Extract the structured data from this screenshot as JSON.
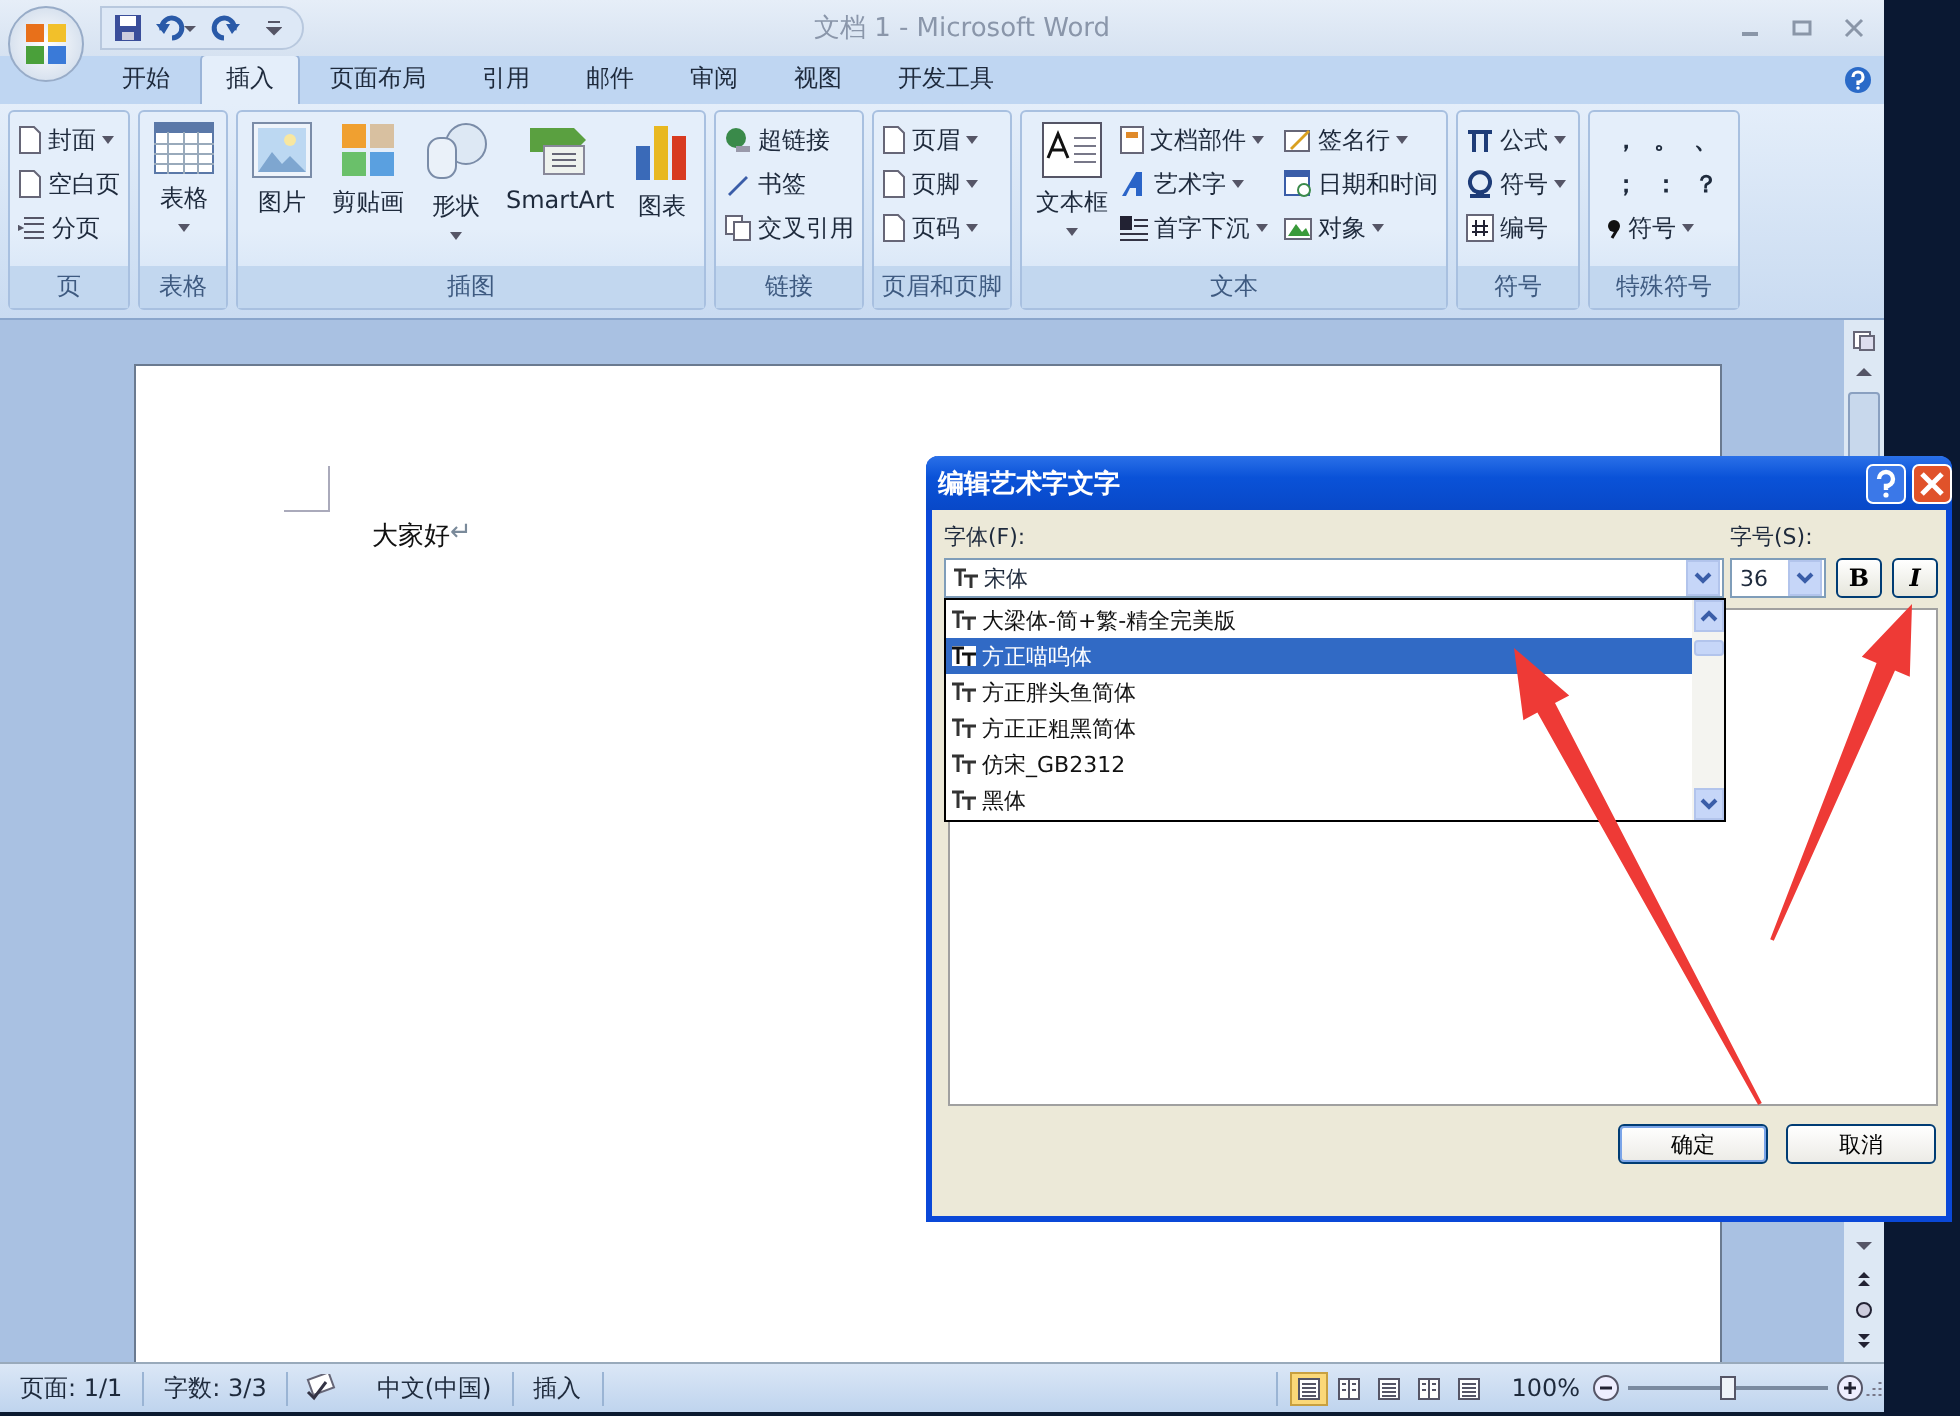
{
  "window": {
    "title": "文档 1 - Microsoft Word"
  },
  "tabs": [
    {
      "label": "开始",
      "selected": false
    },
    {
      "label": "插入",
      "selected": true
    },
    {
      "label": "页面布局",
      "selected": false
    },
    {
      "label": "引用",
      "selected": false
    },
    {
      "label": "邮件",
      "selected": false
    },
    {
      "label": "审阅",
      "selected": false
    },
    {
      "label": "视图",
      "selected": false
    },
    {
      "label": "开发工具",
      "selected": false
    }
  ],
  "ribbon_groups": [
    {
      "label": "页",
      "items": [
        {
          "label": "封面",
          "kind": "small",
          "dropdown": true
        },
        {
          "label": "空白页",
          "kind": "small",
          "dropdown": false
        },
        {
          "label": "分页",
          "kind": "small",
          "dropdown": false
        }
      ]
    },
    {
      "label": "表格",
      "items": [
        {
          "label": "表格",
          "kind": "large",
          "dropdown": true
        }
      ]
    },
    {
      "label": "插图",
      "items": [
        {
          "label": "图片",
          "kind": "large",
          "dropdown": false
        },
        {
          "label": "剪贴画",
          "kind": "large",
          "dropdown": false
        },
        {
          "label": "形状",
          "kind": "large",
          "dropdown": true
        },
        {
          "label": "SmartArt",
          "kind": "large",
          "dropdown": false
        },
        {
          "label": "图表",
          "kind": "large",
          "dropdown": false
        }
      ]
    },
    {
      "label": "链接",
      "items": [
        {
          "label": "超链接",
          "kind": "small",
          "dropdown": false
        },
        {
          "label": "书签",
          "kind": "small",
          "dropdown": false
        },
        {
          "label": "交叉引用",
          "kind": "small",
          "dropdown": false
        }
      ]
    },
    {
      "label": "页眉和页脚",
      "items": [
        {
          "label": "页眉",
          "kind": "small",
          "dropdown": true
        },
        {
          "label": "页脚",
          "kind": "small",
          "dropdown": true
        },
        {
          "label": "页码",
          "kind": "small",
          "dropdown": true
        }
      ]
    },
    {
      "label": "文本",
      "items": [
        {
          "label": "文本框",
          "kind": "large",
          "dropdown": true
        },
        {
          "label": "文档部件",
          "kind": "small",
          "dropdown": true
        },
        {
          "label": "艺术字",
          "kind": "small",
          "dropdown": true
        },
        {
          "label": "首字下沉",
          "kind": "small",
          "dropdown": true
        },
        {
          "label": "签名行",
          "kind": "small",
          "dropdown": true
        },
        {
          "label": "日期和时间",
          "kind": "small",
          "dropdown": false
        },
        {
          "label": "对象",
          "kind": "small",
          "dropdown": true
        }
      ]
    },
    {
      "label": "符号",
      "items": [
        {
          "label": "公式",
          "kind": "small",
          "dropdown": true
        },
        {
          "label": "符号",
          "kind": "small",
          "dropdown": true
        },
        {
          "label": "编号",
          "kind": "small",
          "dropdown": false
        }
      ]
    },
    {
      "label": "特殊符号",
      "items": [
        {
          "label": "，",
          "kind": "punct"
        },
        {
          "label": "。",
          "kind": "punct"
        },
        {
          "label": "、",
          "kind": "punct"
        },
        {
          "label": "；",
          "kind": "punct"
        },
        {
          "label": "：",
          "kind": "punct"
        },
        {
          "label": "？",
          "kind": "punct"
        },
        {
          "label": "符号",
          "kind": "small",
          "dropdown": true
        }
      ]
    }
  ],
  "document": {
    "text": "大家好",
    "paragraph_mark": "↵"
  },
  "dialog": {
    "title": "编辑艺术字文字",
    "font_label": "字体(F):",
    "font_value": "宋体",
    "size_label": "字号(S):",
    "size_value": "36",
    "bold_label": "B",
    "italic_label": "I",
    "font_list": [
      {
        "name": "大梁体-简+繁-精全完美版",
        "selected": false
      },
      {
        "name": "方正喵呜体",
        "selected": true
      },
      {
        "name": "方正胖头鱼简体",
        "selected": false
      },
      {
        "name": "方正正粗黑简体",
        "selected": false
      },
      {
        "name": "仿宋_GB2312",
        "selected": false
      },
      {
        "name": "黑体",
        "selected": false
      }
    ],
    "buttons": [
      "确定",
      "取消"
    ]
  },
  "status_bar": {
    "page": "页面: 1/1",
    "words": "字数: 3/3",
    "language": "中文(中国)",
    "mode": "插入",
    "views": [
      {
        "selected": true
      },
      {
        "selected": false
      },
      {
        "selected": false
      },
      {
        "selected": false
      },
      {
        "selected": false
      }
    ],
    "zoom": "100%",
    "zoom_slider": {
      "level": 0.5
    }
  }
}
